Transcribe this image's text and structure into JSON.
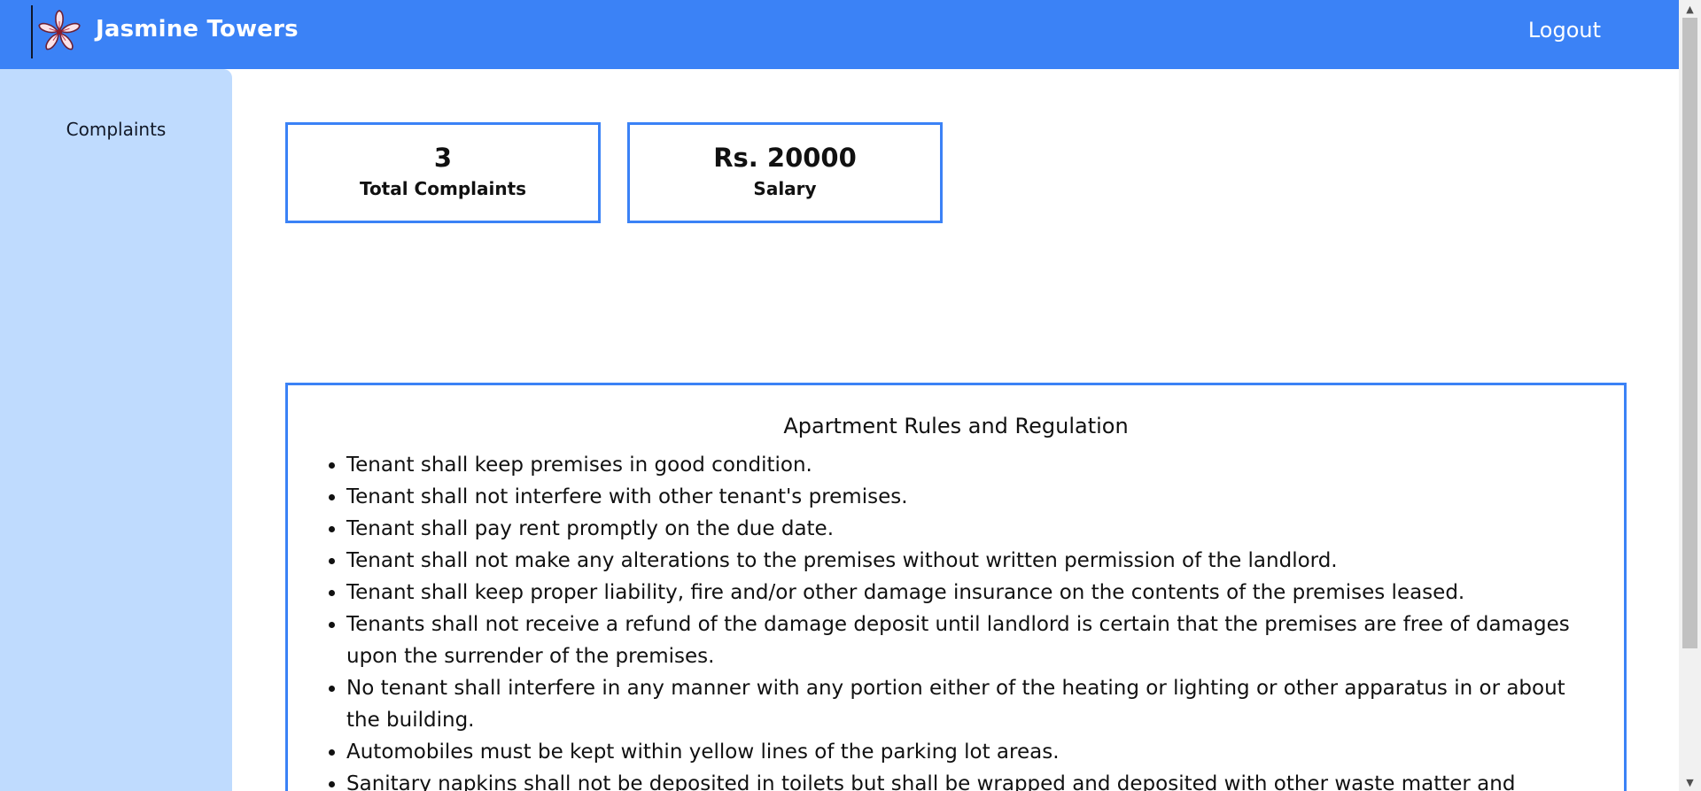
{
  "header": {
    "brand_name": "Jasmine Towers",
    "logout_label": "Logout",
    "logo_icon": "jasmine-flower-icon",
    "bar_color": "#3b82f6"
  },
  "sidebar": {
    "items": [
      {
        "label": "Complaints"
      }
    ],
    "bg_color": "#bfdbfe"
  },
  "stats": [
    {
      "value": "3",
      "label": "Total Complaints"
    },
    {
      "value": "Rs. 20000",
      "label": "Salary"
    }
  ],
  "rules": {
    "title": "Apartment Rules and Regulation",
    "items": [
      "Tenant shall keep premises in good condition.",
      "Tenant shall not interfere with other tenant's premises.",
      "Tenant shall pay rent promptly on the due date.",
      "Tenant shall not make any alterations to the premises without written permission of the landlord.",
      "Tenant shall keep proper liability, fire and/or other damage insurance on the contents of the premises leased.",
      "Tenants shall not receive a refund of the damage deposit until landlord is certain that the premises are free of damages upon the surrender of the premises.",
      "No tenant shall interfere in any manner with any portion either of the heating or lighting or other apparatus in or about the building.",
      "Automobiles must be kept within yellow lines of the parking lot areas.",
      "Sanitary napkins shall not be deposited in toilets but shall be wrapped and deposited with other waste matter and"
    ]
  },
  "scrollbar": {
    "up_arrow_icon": "scroll-up-arrow-icon",
    "down_arrow_icon": "scroll-down-arrow-icon"
  }
}
